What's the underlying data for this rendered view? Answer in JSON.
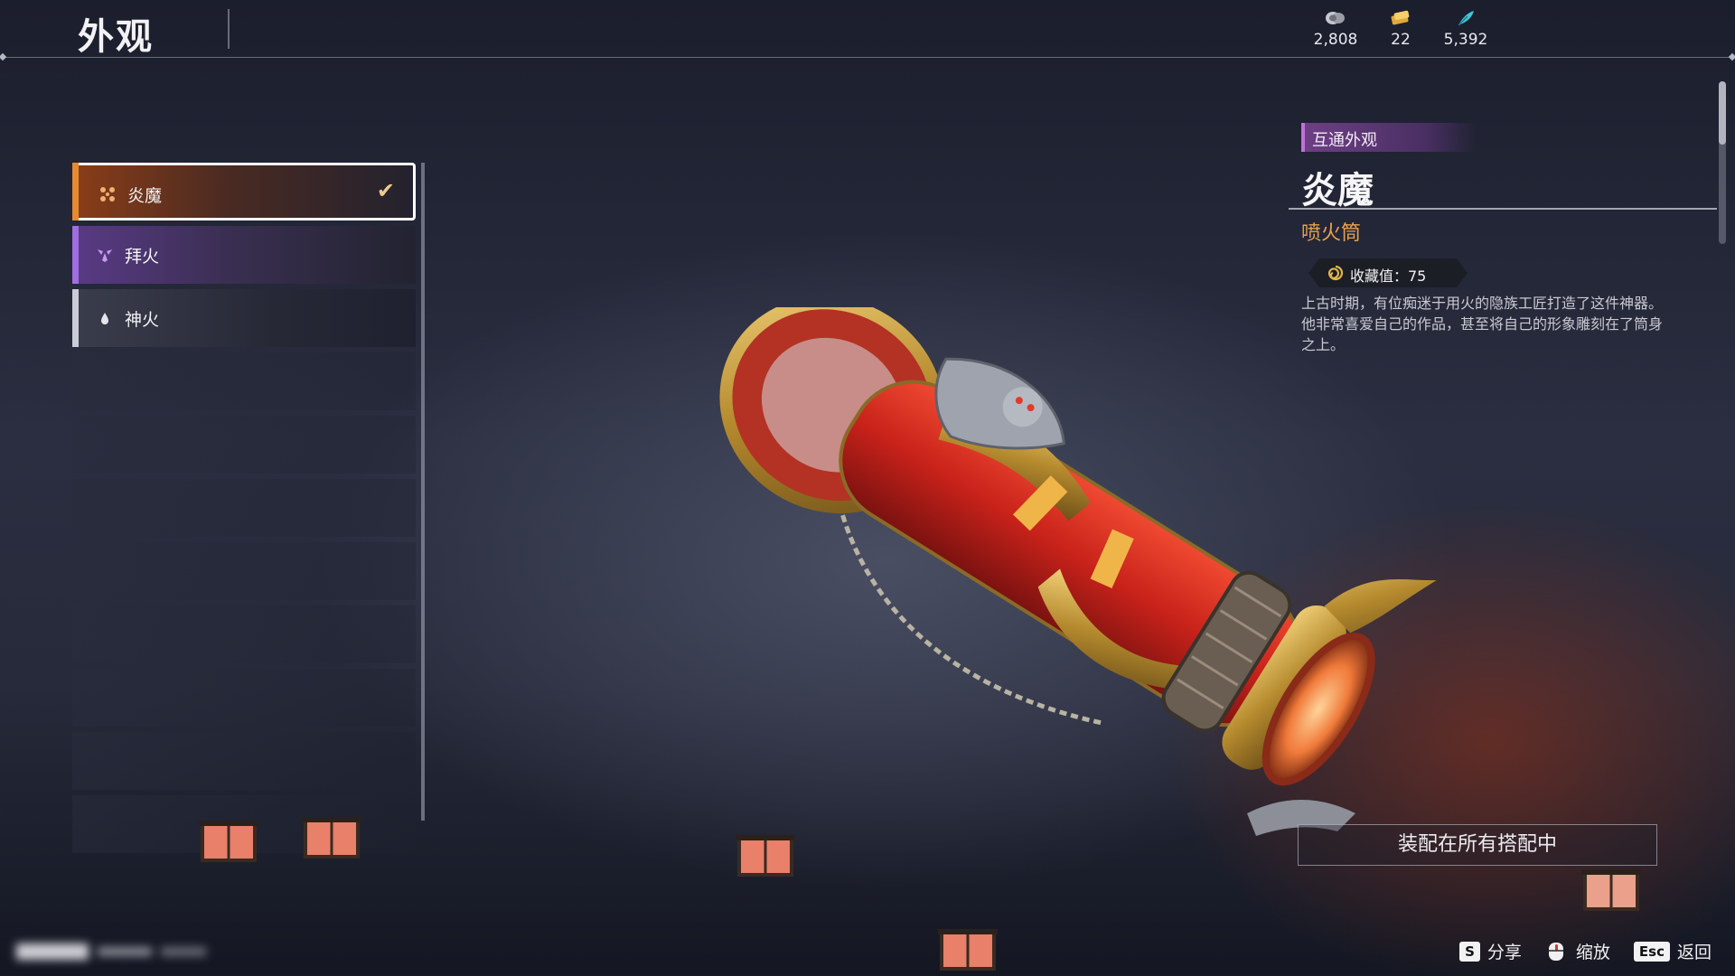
{
  "header": {
    "title": "外观",
    "currencies": [
      {
        "icon": "silver-coin-icon",
        "value": "2,808"
      },
      {
        "icon": "gold-ticket-icon",
        "value": "22"
      },
      {
        "icon": "feather-icon",
        "value": "5,392"
      }
    ]
  },
  "skins": {
    "items": [
      {
        "label": "炎魔",
        "selected": true,
        "rarity_color": "#e58a32"
      },
      {
        "label": "拜火",
        "selected": false,
        "rarity_color": "#a06ee0"
      },
      {
        "label": "神火",
        "selected": false,
        "rarity_color": "#c9ccd6"
      }
    ],
    "empty_slot_count": 8
  },
  "detail": {
    "tag": "互通外观",
    "name": "炎魔",
    "type": "喷火筒",
    "collection_label": "收藏值：75",
    "description": "上古时期，有位痴迷于用火的隐族工匠打造了这件神器。他非常喜爱自己的作品，甚至将自己的形象雕刻在了筒身之上。",
    "equip_button": "装配在所有搭配中"
  },
  "hints": {
    "share_key": "S",
    "share_label": "分享",
    "zoom_label": "缩放",
    "back_key": "Esc",
    "back_label": "返回"
  }
}
